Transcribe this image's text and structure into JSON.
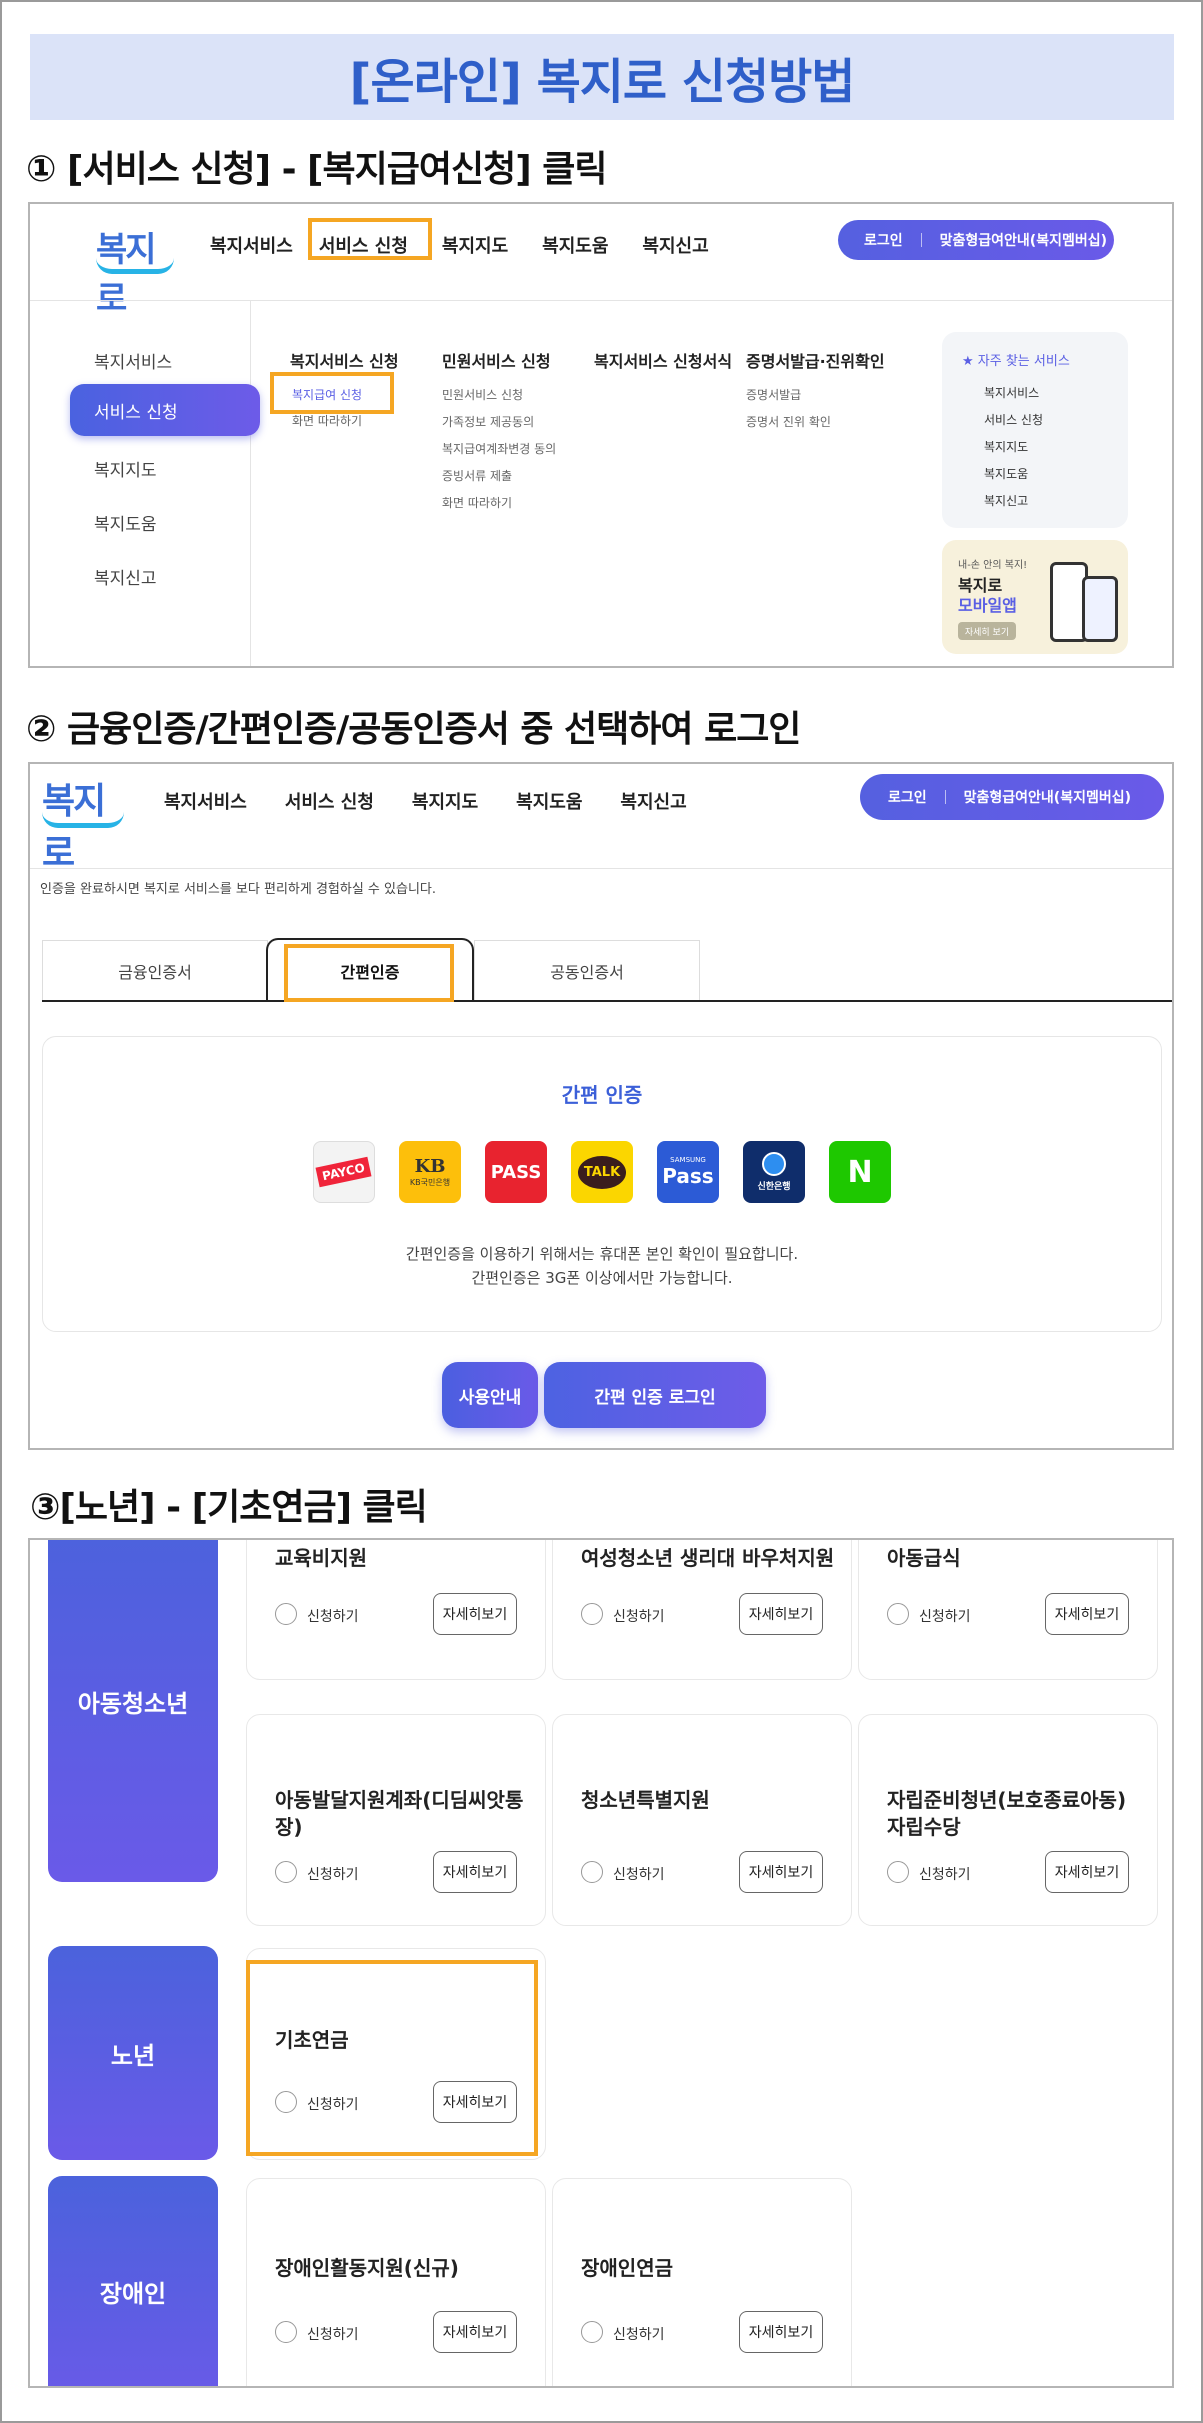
{
  "title": "[온라인] 복지로 신청방법",
  "steps": {
    "s1": "① [서비스 신청] - [복지급여신청] 클릭",
    "s2": "② 금융인증/간편인증/공동인증서 중 선택하여 로그인",
    "s3": "③[노년] - [기초연금] 클릭"
  },
  "header": {
    "logo": "복지로",
    "nav": [
      "복지서비스",
      "서비스 신청",
      "복지지도",
      "복지도움",
      "복지신고"
    ],
    "login": "로그인",
    "custom_info": "맞춤형급여안내(복지멤버십)"
  },
  "menu": {
    "side": [
      "복지서비스",
      "서비스 신청",
      "복지지도",
      "복지도움",
      "복지신고"
    ],
    "columns": [
      {
        "title": "복지서비스 신청",
        "items": [
          "복지급여 신청",
          "화면 따라하기"
        ]
      },
      {
        "title": "민원서비스 신청",
        "items": [
          "민원서비스 신청",
          "가족정보 제공동의",
          "복지급여계좌변경 동의",
          "증빙서류 제출",
          "화면 따라하기"
        ]
      },
      {
        "title": "복지서비스 신청서식",
        "items": []
      },
      {
        "title": "증명서발급·진위확인",
        "items": [
          "증명서발급",
          "증명서 진위 확인"
        ]
      }
    ],
    "fav_title": "자주 찾는 서비스",
    "fav_items": [
      "복지서비스",
      "서비스 신청",
      "복지지도",
      "복지도움",
      "복지신고"
    ],
    "app_sub": "내-손 안의 복지!",
    "app_t1": "복지로",
    "app_t2": "모바일앱",
    "app_btn": "자세히 보기"
  },
  "login": {
    "notice": "인증을 완료하시면 복지로 서비스를 보다 편리하게 경험하실 수 있습니다.",
    "tabs": [
      "금융인증서",
      "간편인증",
      "공동인증서"
    ],
    "box_title": "간편 인증",
    "providers": [
      "PAYCO",
      "KB",
      "PASS",
      "TALK",
      "Pass",
      "신한은행",
      "N"
    ],
    "kb_sub": "KB국민은행",
    "samsung_sub": "SAMSUNG",
    "desc1": "간편인증을 이용하기 위해서는 휴대폰 본인 확인이 필요합니다.",
    "desc2": "간편인증은 3G폰 이상에서만 가능합니다.",
    "guide_btn": "사용안내",
    "login_btn": "간편 인증 로그인"
  },
  "services": {
    "apply": "신청하기",
    "detail": "자세히보기",
    "categories": [
      "아동청소년",
      "노년",
      "장애인"
    ],
    "cards": [
      "교육비지원",
      "여성청소년 생리대 바우처지원",
      "아동급식",
      "아동발달지원계좌(디딤씨앗통장)",
      "청소년특별지원",
      "자립준비청년(보호종료아동) 자립수당",
      "기초연금",
      "장애인활동지원(신규)",
      "장애인연금"
    ]
  },
  "colors": {
    "accent": "#5a5fe4",
    "highlight": "#f5a623",
    "banner": "#dbe3f8",
    "title": "#2f5fc9"
  }
}
